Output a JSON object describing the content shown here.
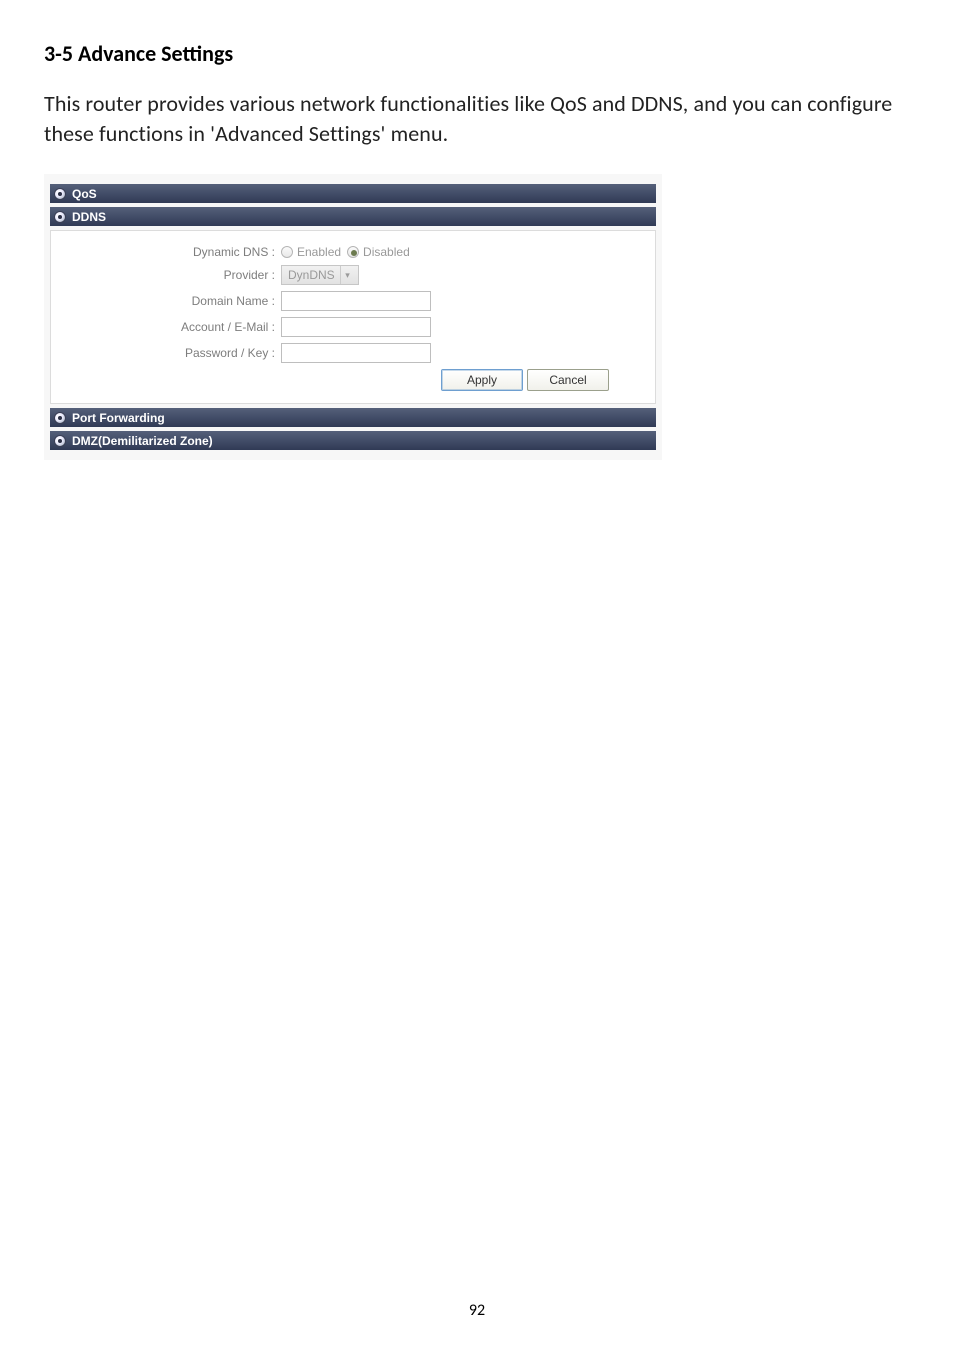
{
  "heading": "3-5 Advance Settings",
  "body": "This router provides various network functionalities like QoS and DDNS, and you can configure these functions in 'Advanced Settings' menu.",
  "panel": {
    "qos": {
      "title": "QoS"
    },
    "ddns": {
      "title": "DDNS",
      "fields": {
        "dynamic_dns": {
          "label": "Dynamic DNS :",
          "options": {
            "enabled": "Enabled",
            "disabled": "Disabled"
          },
          "selected": "disabled"
        },
        "provider": {
          "label": "Provider :",
          "value": "DynDNS"
        },
        "domain_name": {
          "label": "Domain Name :",
          "value": ""
        },
        "account_email": {
          "label": "Account / E-Mail :",
          "value": ""
        },
        "password_key": {
          "label": "Password / Key :",
          "value": ""
        }
      },
      "buttons": {
        "apply": "Apply",
        "cancel": "Cancel"
      }
    },
    "port_forwarding": {
      "title": "Port Forwarding"
    },
    "dmz": {
      "title": "DMZ(Demilitarized Zone)"
    }
  },
  "page_number": "92"
}
